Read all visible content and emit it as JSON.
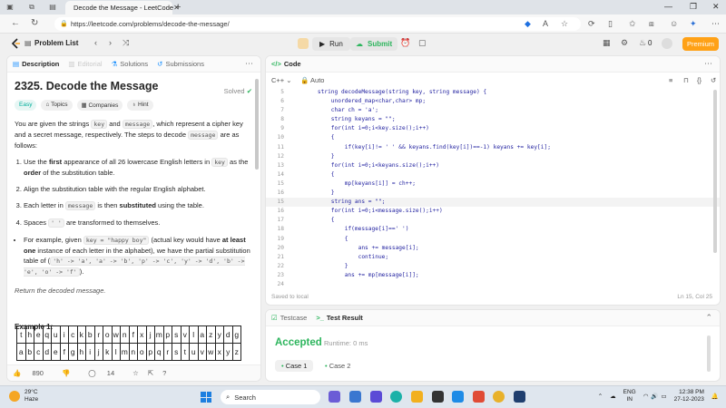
{
  "browser": {
    "tab_title": "Decode the Message - LeetCode",
    "url": "https://leetcode.com/problems/decode-the-message/"
  },
  "header": {
    "problem_list": "Problem List",
    "run": "Run",
    "submit": "Submit",
    "streak": "0",
    "premium": "Premium"
  },
  "left": {
    "tabs": [
      "Description",
      "Editorial",
      "Solutions",
      "Submissions"
    ],
    "title": "2325. Decode the Message",
    "solved": "Solved",
    "chips": [
      "Easy",
      "Topics",
      "Companies",
      "Hint"
    ],
    "intro_1": "You are given the strings ",
    "intro_key": "key",
    "intro_2": " and ",
    "intro_message": "message",
    "intro_3": ", which represent a cipher key and a secret message, respectively. The steps to decode ",
    "intro_message2": "message",
    "intro_4": " are as follows:",
    "step1_a": "Use the ",
    "step1_b": "first",
    "step1_c": " appearance of all 26 lowercase English letters in ",
    "step1_key": "key",
    "step1_d": " as the ",
    "step1_e": "order",
    "step1_f": " of the substitution table.",
    "step2": "Align the substitution table with the regular English alphabet.",
    "step3_a": "Each letter in ",
    "step3_msg": "message",
    "step3_b": " is then ",
    "step3_c": "substituted",
    "step3_d": " using the table.",
    "step4_a": "Spaces ",
    "step4_code": "' '",
    "step4_b": " are transformed to themselves.",
    "bullet_a": "For example, given ",
    "bullet_code1": "key = \"happy boy\"",
    "bullet_b": " (actual key would have ",
    "bullet_c": "at least one",
    "bullet_d": " instance of each letter in the alphabet), we have the partial substitution table of (",
    "bullet_code2": "'h' -> 'a', 'a' -> 'b', 'p' -> 'c', 'y' -> 'd', 'b' -> 'e', 'o' -> 'f'",
    "bullet_e": ").",
    "return_text": "Return the decoded message.",
    "example_title": "Example 1:",
    "grid_row1": [
      "t",
      "h",
      "e",
      "q",
      "u",
      "i",
      "c",
      "k",
      "b",
      "r",
      "o",
      "w",
      "n",
      "f",
      "x",
      "j",
      "m",
      "p",
      "s",
      "v",
      "l",
      "a",
      "z",
      "y",
      "d",
      "g"
    ],
    "grid_row2": [
      "a",
      "b",
      "c",
      "d",
      "e",
      "f",
      "g",
      "h",
      "i",
      "j",
      "k",
      "l",
      "m",
      "n",
      "o",
      "p",
      "q",
      "r",
      "s",
      "t",
      "u",
      "v",
      "w",
      "x",
      "y",
      "z"
    ],
    "likes": "890",
    "comments": "14"
  },
  "code": {
    "tab": "Code",
    "language": "C++",
    "auto": "Auto",
    "lines": [
      {
        "n": "5",
        "t": "    string decodeMessage(string key, string message) {"
      },
      {
        "n": "6",
        "t": "        unordered_map<char,char> mp;"
      },
      {
        "n": "7",
        "t": "        char ch = 'a';"
      },
      {
        "n": "8",
        "t": "        string keyans = \"\";"
      },
      {
        "n": "9",
        "t": "        for(int i=0;i<key.size();i++)"
      },
      {
        "n": "10",
        "t": "        {"
      },
      {
        "n": "11",
        "t": "            if(key[i]!= ' ' && keyans.find(key[i])==-1) keyans += key[i];"
      },
      {
        "n": "12",
        "t": "        }"
      },
      {
        "n": "13",
        "t": "        for(int i=0;i<keyans.size();i++)"
      },
      {
        "n": "14",
        "t": "        {"
      },
      {
        "n": "15",
        "t": "            mp[keyans[i]] = ch++;"
      },
      {
        "n": "16",
        "t": "        }"
      },
      {
        "n": "15",
        "t": "        string ans = \"\";"
      },
      {
        "n": "16",
        "t": "        for(int i=0;i<message.size();i++)"
      },
      {
        "n": "17",
        "t": "        {"
      },
      {
        "n": "18",
        "t": "            if(message[i]==' ')"
      },
      {
        "n": "19",
        "t": "            {"
      },
      {
        "n": "20",
        "t": "                ans += message[i];"
      },
      {
        "n": "21",
        "t": "                continue;"
      },
      {
        "n": "22",
        "t": "            }"
      },
      {
        "n": "23",
        "t": "            ans += mp[message[i]];"
      },
      {
        "n": "24",
        "t": ""
      },
      {
        "n": "25",
        "t": "        }"
      }
    ],
    "saved": "Saved to local",
    "position": "Ln 15, Col 25"
  },
  "test": {
    "tab_testcase": "Testcase",
    "tab_result": "Test Result",
    "status": "Accepted",
    "runtime": "Runtime: 0 ms",
    "cases": [
      "Case 1",
      "Case 2"
    ]
  },
  "taskbar": {
    "temp": "29°C",
    "weather": "Haze",
    "search": "Search",
    "lang1": "ENG",
    "lang2": "IN",
    "time": "12:38 PM",
    "date": "27-12-2023"
  },
  "colors": {
    "accent": "#ffa116",
    "accepted": "#2db55d",
    "easy": "#00af9b"
  }
}
